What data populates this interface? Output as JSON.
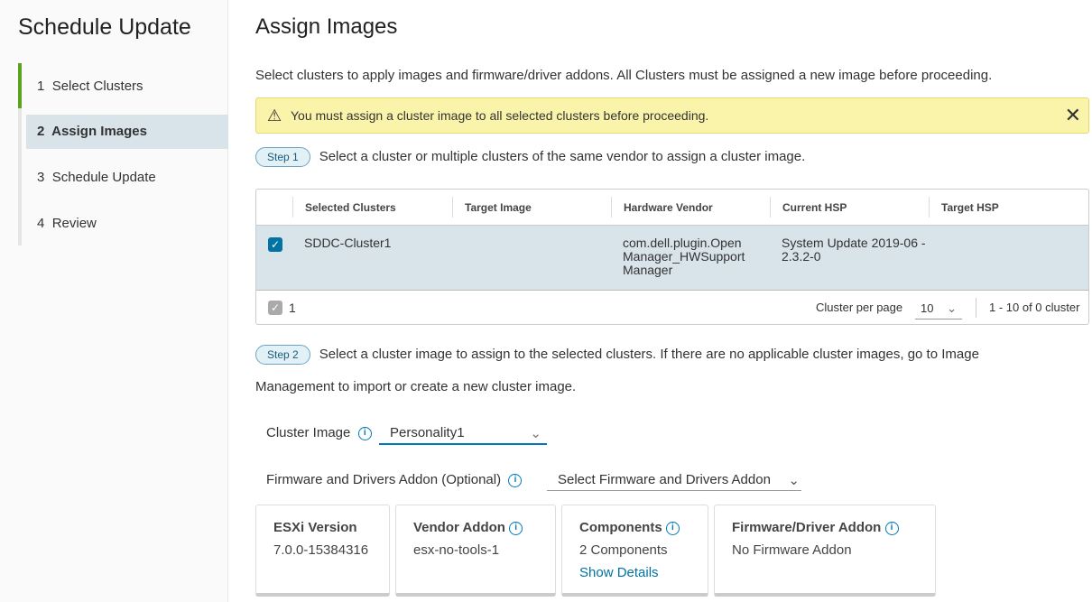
{
  "sidebar": {
    "title": "Schedule Update",
    "steps": [
      {
        "num": "1",
        "label": "Select Clusters"
      },
      {
        "num": "2",
        "label": "Assign Images"
      },
      {
        "num": "3",
        "label": "Schedule Update"
      },
      {
        "num": "4",
        "label": "Review"
      }
    ]
  },
  "main": {
    "title": "Assign Images",
    "intro": "Select clusters to apply images and firmware/driver addons. All Clusters must be assigned a new image before proceeding.",
    "alert": "You must assign a cluster image to all selected clusters before proceeding.",
    "step1": {
      "badge": "Step 1",
      "text": "Select a cluster or multiple clusters of the same vendor to assign a cluster image."
    },
    "table": {
      "headers": [
        "Selected Clusters",
        "Target Image",
        "Hardware Vendor",
        "Current HSP",
        "Target HSP"
      ],
      "rows": [
        {
          "cluster": "SDDC-Cluster1",
          "target_image": "",
          "vendor": "com.dell.plugin.Open Manager_HWSupport Manager",
          "current_hsp": "System Update 2019-06 - 2.3.2-0",
          "target_hsp": ""
        }
      ],
      "selected_count": "1",
      "per_page_label": "Cluster per page",
      "per_page": "10",
      "range": "1 - 10 of 0 cluster"
    },
    "step2": {
      "badge": "Step 2",
      "text": "Select a cluster image to assign to the selected clusters. If there are no applicable cluster images, go to Image",
      "text2": "Management to import or create a new cluster image."
    },
    "cluster_image": {
      "label": "Cluster Image",
      "value": "Personality1"
    },
    "addon": {
      "label": "Firmware and Drivers Addon (Optional)",
      "placeholder": "Select Firmware and Drivers Addon"
    },
    "cards": [
      {
        "title": "ESXi Version",
        "value": "7.0.0-15384316"
      },
      {
        "title": "Vendor Addon",
        "value": "esx-no-tools-1"
      },
      {
        "title": "Components",
        "value": "2 Components",
        "link": "Show Details"
      },
      {
        "title": "Firmware/Driver Addon",
        "value": "No Firmware Addon"
      }
    ]
  }
}
